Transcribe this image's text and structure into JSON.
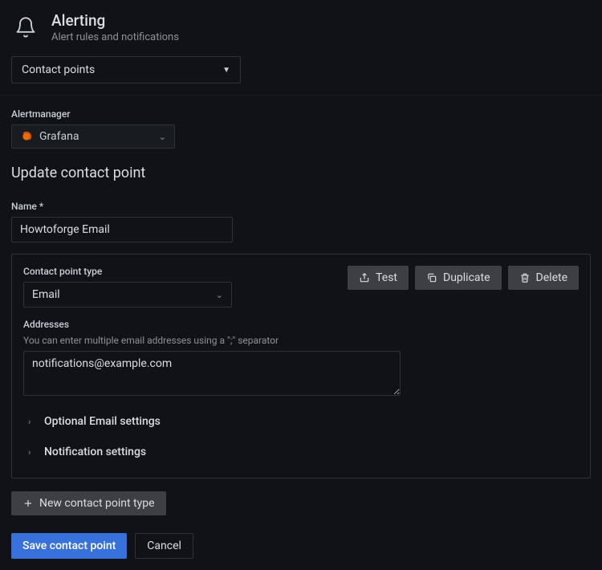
{
  "header": {
    "title": "Alerting",
    "subtitle": "Alert rules and notifications"
  },
  "nav": {
    "selected": "Contact points"
  },
  "alertmanager": {
    "label": "Alertmanager",
    "value": "Grafana"
  },
  "section": {
    "title": "Update contact point"
  },
  "form": {
    "name_label": "Name",
    "name_value": "Howtoforge Email",
    "type_label": "Contact point type",
    "type_value": "Email",
    "addresses_label": "Addresses",
    "addresses_help": "You can enter multiple email addresses using a \";\" separator",
    "addresses_value": "notifications@example.com",
    "collapse_optional": "Optional Email settings",
    "collapse_notification": "Notification settings"
  },
  "buttons": {
    "test": "Test",
    "duplicate": "Duplicate",
    "delete": "Delete",
    "new_type": "New contact point type",
    "save": "Save contact point",
    "cancel": "Cancel"
  }
}
